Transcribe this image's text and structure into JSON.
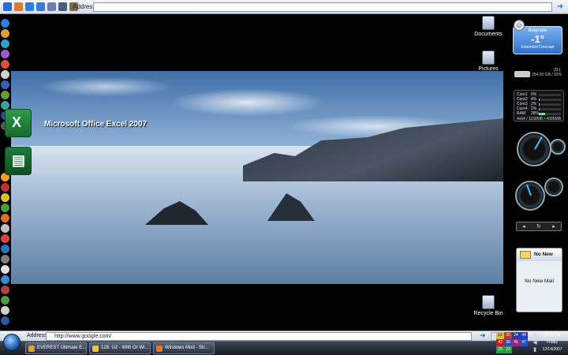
{
  "top_bar": {
    "address_label": "Address",
    "address_value": ""
  },
  "desktop": {
    "excel_label": "Microsoft Office Excel 2007",
    "icons": [
      {
        "label": "Documents"
      },
      {
        "label": "Pictures"
      },
      {
        "label": "Recycle Bin"
      }
    ]
  },
  "weather": {
    "city": "Belgrade",
    "temp": "-1°",
    "forecast": "Extended Forecast"
  },
  "drive": {
    "name": "(D:)",
    "info": "254.65 GB / 92%"
  },
  "cpu": {
    "rows": [
      {
        "name": "Core1",
        "value": "0%",
        "fill": 0
      },
      {
        "name": "Core2",
        "value": "4%",
        "fill": 4
      },
      {
        "name": "Core3",
        "value": "2%",
        "fill": 2
      },
      {
        "name": "Core4",
        "value": "2%",
        "fill": 2
      },
      {
        "name": "RAM",
        "value": "28%",
        "fill": 28
      }
    ],
    "footer": "4x64 / 1158MB / 4095MB"
  },
  "mail": {
    "header": "No New",
    "body": "No New Mail"
  },
  "bottom_bar": {
    "address_label": "Address",
    "address_value": "http://www.google.com/"
  },
  "taskbar": {
    "tasks": [
      {
        "label": "EVEREST Ultimate E..."
      },
      {
        "label": "128. U2 - With Or Wi..."
      },
      {
        "label": "Windows Mod - Str..."
      }
    ]
  },
  "tray": {
    "cells": [
      "12",
      "20",
      "24",
      "44",
      "43",
      "39",
      "45",
      "47",
      "25",
      "23",
      "",
      ""
    ]
  },
  "clock": {
    "time": "12:11 PM",
    "day": "Friday",
    "date": "12/14/2007"
  },
  "colors": {
    "accent": "#2e6fc8",
    "task_bg": "#2a3140",
    "cpu_bar": "#6fe08a"
  }
}
